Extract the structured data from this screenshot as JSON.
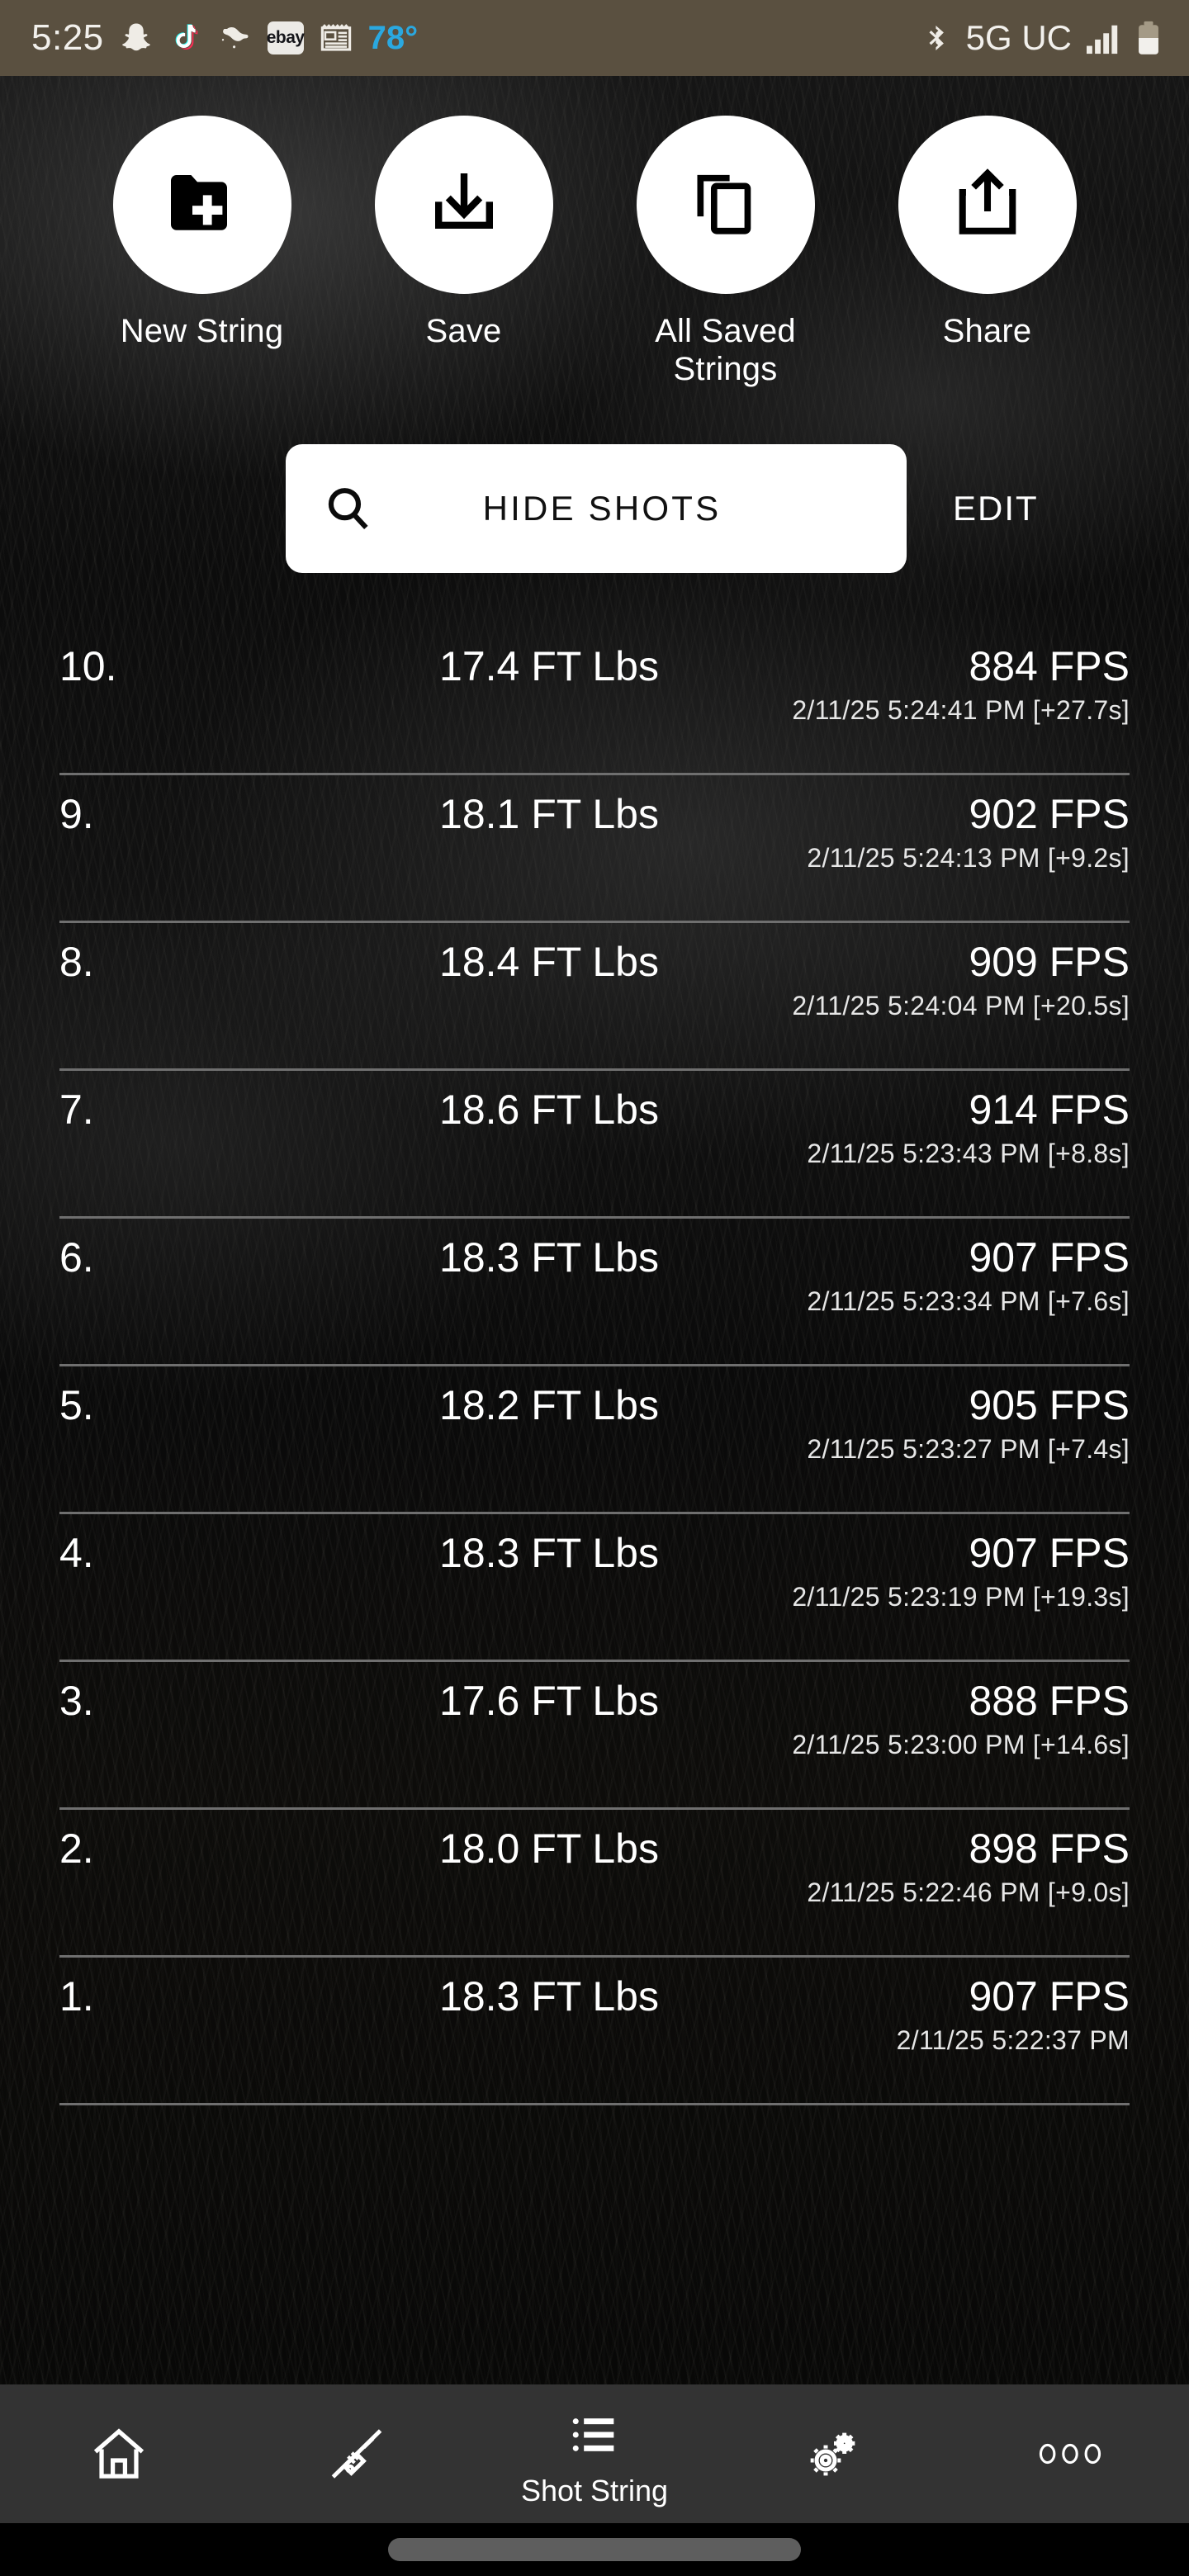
{
  "status_bar": {
    "time": "5:25",
    "temperature": "78°",
    "network": "5G UC",
    "icons": [
      "snapchat-icon",
      "tiktok-icon",
      "app-icon",
      "ebay-icon",
      "news-icon",
      "bluetooth-icon",
      "signal-icon",
      "battery-icon"
    ],
    "ebay_label": "ebay",
    "colors": {
      "bar_background": "#5a5040",
      "temp_text": "#2aa8e0",
      "text": "#f2f0ec"
    }
  },
  "actions": [
    {
      "label": "New String",
      "icon": "folder-plus-icon"
    },
    {
      "label": "Save",
      "icon": "download-icon"
    },
    {
      "label": "All Saved Strings",
      "icon": "copy-icon"
    },
    {
      "label": "Share",
      "icon": "share-upload-icon"
    }
  ],
  "search": {
    "label": "HIDE SHOTS",
    "icon": "search-icon",
    "edit_label": "EDIT"
  },
  "shots": [
    {
      "index": "10.",
      "energy": "17.4 FT Lbs",
      "speed": "884 FPS",
      "meta": "2/11/25 5:24:41 PM [+27.7s]"
    },
    {
      "index": "9.",
      "energy": "18.1 FT Lbs",
      "speed": "902 FPS",
      "meta": "2/11/25 5:24:13 PM [+9.2s]"
    },
    {
      "index": "8.",
      "energy": "18.4 FT Lbs",
      "speed": "909 FPS",
      "meta": "2/11/25 5:24:04 PM [+20.5s]"
    },
    {
      "index": "7.",
      "energy": "18.6 FT Lbs",
      "speed": "914 FPS",
      "meta": "2/11/25 5:23:43 PM [+8.8s]"
    },
    {
      "index": "6.",
      "energy": "18.3 FT Lbs",
      "speed": "907 FPS",
      "meta": "2/11/25 5:23:34 PM [+7.6s]"
    },
    {
      "index": "5.",
      "energy": "18.2 FT Lbs",
      "speed": "905 FPS",
      "meta": "2/11/25 5:23:27 PM [+7.4s]"
    },
    {
      "index": "4.",
      "energy": "18.3 FT Lbs",
      "speed": "907 FPS",
      "meta": "2/11/25 5:23:19 PM [+19.3s]"
    },
    {
      "index": "3.",
      "energy": "17.6 FT Lbs",
      "speed": "888 FPS",
      "meta": "2/11/25 5:23:00 PM [+14.6s]"
    },
    {
      "index": "2.",
      "energy": "18.0 FT Lbs",
      "speed": "898 FPS",
      "meta": "2/11/25 5:22:46 PM [+9.0s]"
    },
    {
      "index": "1.",
      "energy": "18.3 FT Lbs",
      "speed": "907 FPS",
      "meta": "2/11/25 5:22:37 PM"
    }
  ],
  "bottom_nav": {
    "items": [
      {
        "icon": "home-icon",
        "label": "",
        "active": false
      },
      {
        "icon": "rifle-icon",
        "label": "",
        "active": false
      },
      {
        "icon": "list-icon",
        "label": "Shot String",
        "active": true
      },
      {
        "icon": "gears-icon",
        "label": "",
        "active": false
      },
      {
        "icon": "more-dots-icon",
        "label": "",
        "active": false
      }
    ],
    "background": "#333333"
  }
}
